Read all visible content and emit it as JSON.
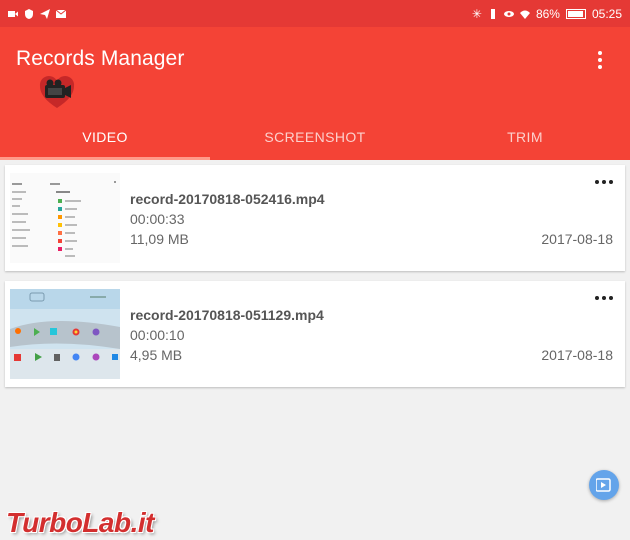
{
  "status_bar": {
    "battery": "86%",
    "time": "05:25"
  },
  "app": {
    "title": "Records Manager"
  },
  "tabs": [
    {
      "label": "VIDEO",
      "active": true
    },
    {
      "label": "SCREENSHOT",
      "active": false
    },
    {
      "label": "TRIM",
      "active": false
    }
  ],
  "records": [
    {
      "name": "record-20170818-052416.mp4",
      "duration": "00:00:33",
      "size": "11,09 MB",
      "date": "2017-08-18"
    },
    {
      "name": "record-20170818-051129.mp4",
      "duration": "00:00:10",
      "size": "4,95 MB",
      "date": "2017-08-18"
    }
  ],
  "watermark": "TurboLab.it",
  "colors": {
    "primary": "#f44336",
    "status_bar": "#e53935",
    "fab": "#64a4ea"
  }
}
